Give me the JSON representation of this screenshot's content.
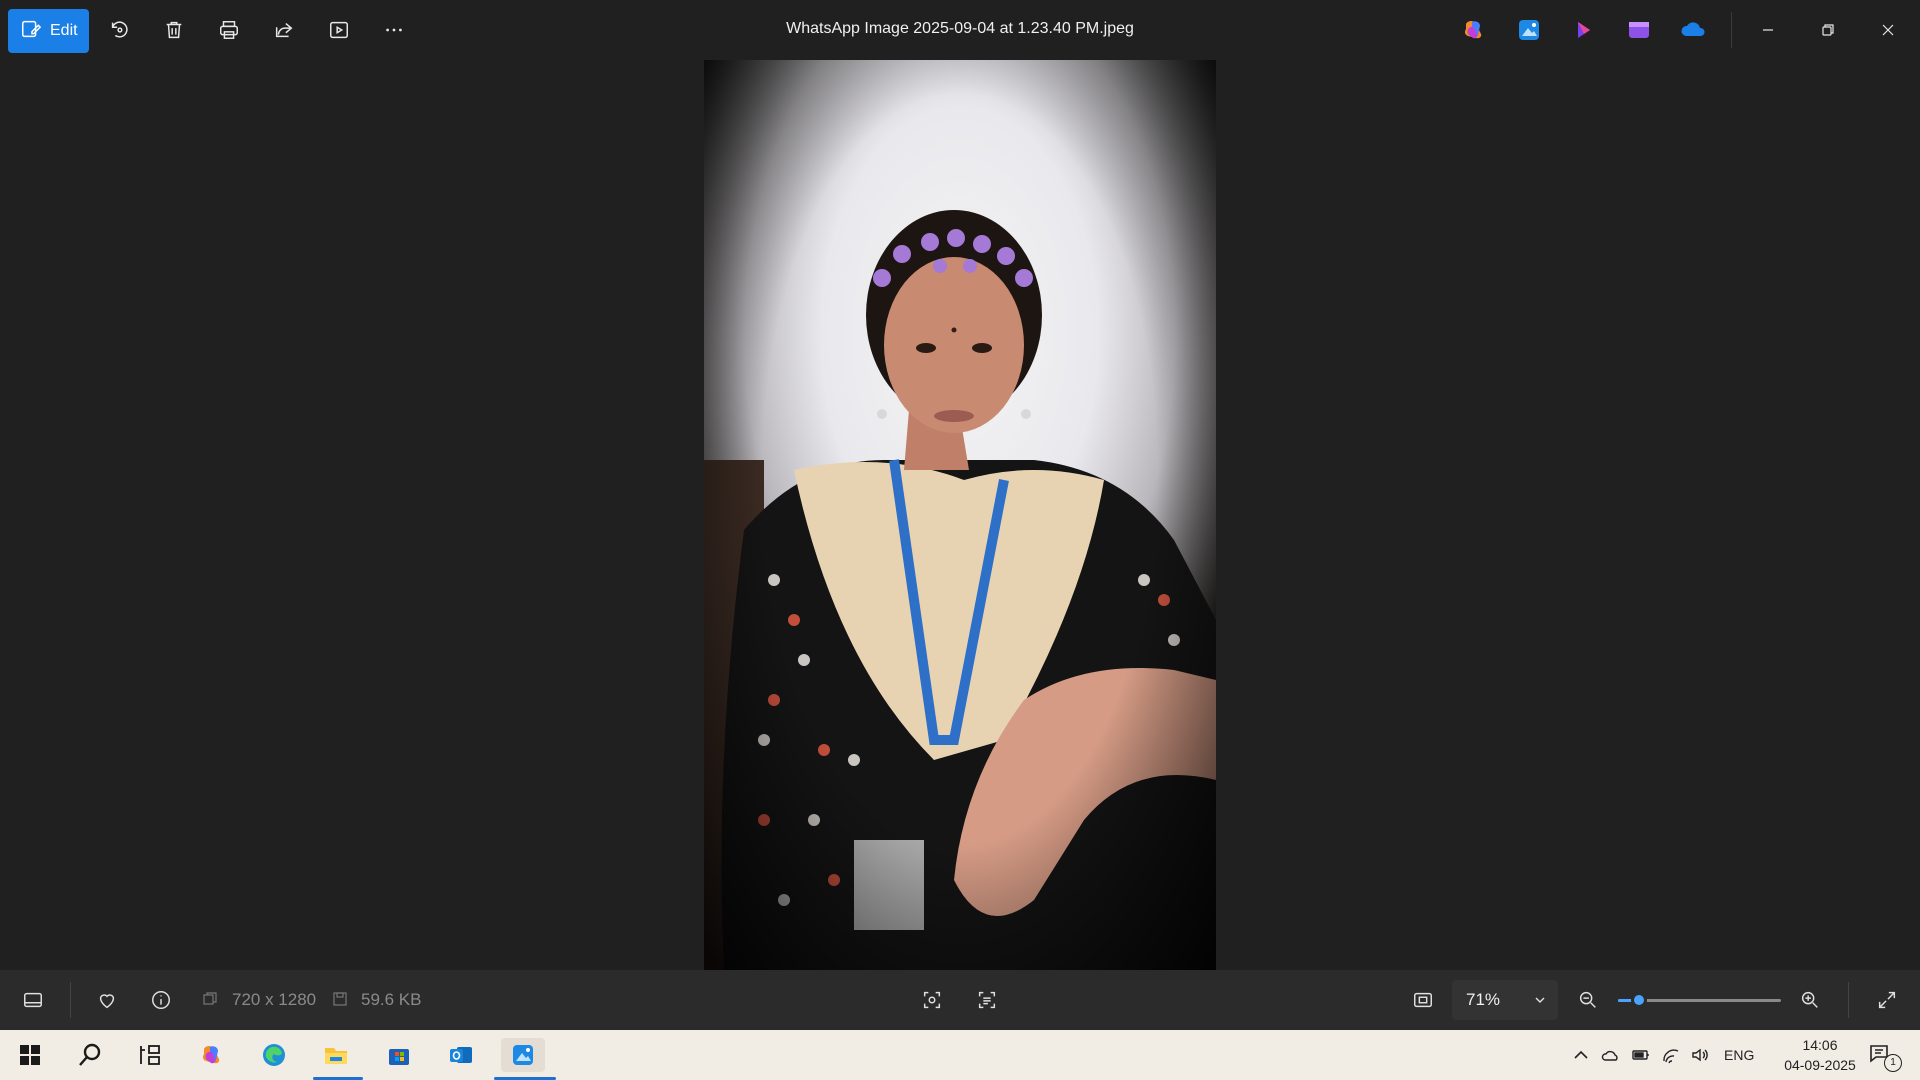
{
  "window": {
    "title": "WhatsApp Image 2025-09-04 at 1.23.40 PM.jpeg"
  },
  "toolbar": {
    "edit_label": "Edit",
    "icons": [
      "edit-icon",
      "rotate-icon",
      "delete-icon",
      "print-icon",
      "share-icon",
      "slideshow-icon",
      "more-icon"
    ],
    "app_icons": [
      "copilot-icon",
      "photos-icon",
      "clipchamp-icon",
      "video-editor-icon",
      "onedrive-icon"
    ]
  },
  "photo": {
    "description_icon": "portrait-photo"
  },
  "bottombar": {
    "dimensions": "720 x 1280",
    "file_size": "59.6 KB",
    "zoom_value": "71%",
    "zoom_fraction": 0.13
  },
  "taskbar": {
    "apps": [
      "start-icon",
      "search-icon",
      "task-view-icon",
      "copilot-icon",
      "edge-icon",
      "file-explorer-icon",
      "store-icon",
      "outlook-icon",
      "photos-icon"
    ],
    "language": "ENG",
    "time": "14:06",
    "date": "04-09-2025",
    "notification_count": "1"
  },
  "colors": {
    "accent": "#1a80e8",
    "background": "#202020",
    "bottombar": "#2b2b2b",
    "taskbar": "#f1ece4"
  }
}
